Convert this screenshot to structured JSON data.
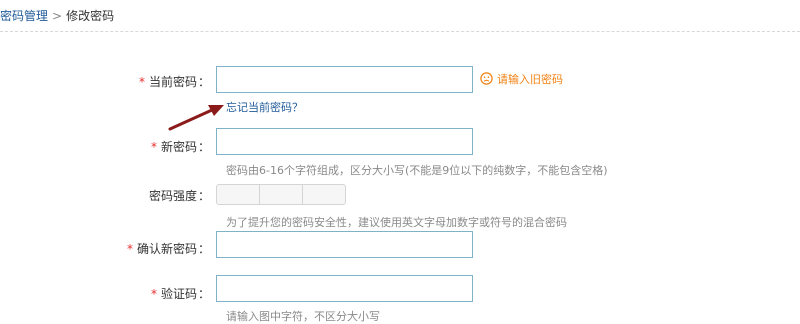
{
  "breadcrumb": {
    "parent": "密码管理",
    "separator": ">",
    "current": "修改密码"
  },
  "required_mark": "*",
  "colon": "：",
  "form": {
    "current_password": {
      "label": "当前密码",
      "value": "",
      "error": "请输入旧密码",
      "forgot_link": "忘记当前密码？"
    },
    "new_password": {
      "label": "新密码",
      "value": "",
      "hint": "密码由6-16个字符组成，区分大小写(不能是9位以下的纯数字，不能包含空格)"
    },
    "strength": {
      "label": "密码强度",
      "segments": 3,
      "hint": "为了提升您的密码安全性，建议使用英文字母加数字或符号的混合密码"
    },
    "confirm_password": {
      "label": "确认新密码",
      "value": ""
    },
    "captcha": {
      "label": "验证码",
      "value": "",
      "hint": "请输入图中字符，不区分大小写"
    }
  },
  "colors": {
    "link": "#1f5a98",
    "required": "#e62f2f",
    "error": "#f08214",
    "input_border": "#7eb2c6",
    "arrow": "#8b1a1a",
    "hint": "#8a8a8a"
  },
  "icons": {
    "error": "sad-face-icon",
    "annotation": "pointer-arrow-icon"
  }
}
